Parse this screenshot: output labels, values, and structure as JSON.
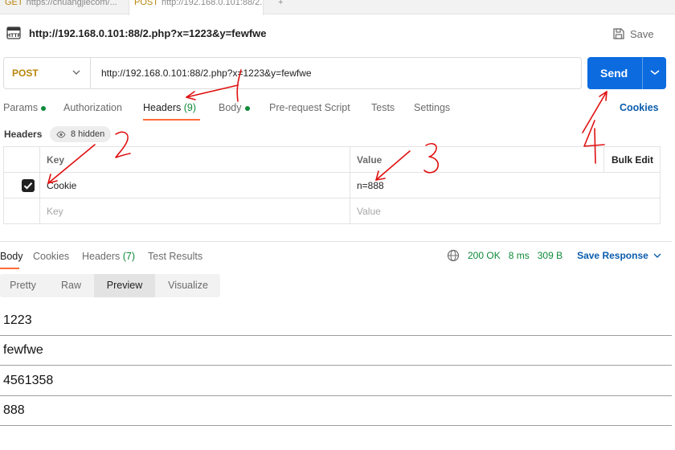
{
  "browser_tabs": [
    {
      "method": "GET",
      "label": "https://chuangjiecom/..."
    },
    {
      "method": "POST",
      "label": "http://192.168.0.101:88/2..."
    },
    {
      "label": "+"
    }
  ],
  "request": {
    "icon": "http-file-icon",
    "name": "http://192.168.0.101:88/2.php?x=1223&y=fewfwe",
    "save_label": "Save"
  },
  "url_bar": {
    "method": "POST",
    "url": "http://192.168.0.101:88/2.php?x=1223&y=fewfwe",
    "send_label": "Send"
  },
  "request_tabs": {
    "params": "Params",
    "authorization": "Authorization",
    "headers": "Headers",
    "headers_count": "(9)",
    "body": "Body",
    "pre_request": "Pre-request Script",
    "tests": "Tests",
    "settings": "Settings",
    "cookies": "Cookies"
  },
  "headers_section": {
    "label": "Headers",
    "hidden": "8 hidden",
    "columns": {
      "key": "Key",
      "value": "Value",
      "bulk_edit": "Bulk Edit"
    },
    "rows": [
      {
        "checked": true,
        "key": "Cookie",
        "value": "n=888"
      }
    ],
    "placeholder": {
      "key": "Key",
      "value": "Value"
    }
  },
  "response_tabs": {
    "body": "Body",
    "cookies": "Cookies",
    "headers": "Headers",
    "headers_count": "(7)",
    "test_results": "Test Results"
  },
  "response_status": {
    "status": "200 OK",
    "time": "8 ms",
    "size": "309 B",
    "save_response": "Save Response"
  },
  "view_modes": [
    "Pretty",
    "Raw",
    "Preview",
    "Visualize"
  ],
  "active_view": "Preview",
  "preview_output": [
    "1223",
    "fewfwe",
    "4561358",
    "888"
  ],
  "annotations": [
    "1",
    "2",
    "3",
    "4"
  ],
  "colors": {
    "accent": "#ff6c37",
    "send": "#0b6bdf",
    "method_post": "#b8860b",
    "status_ok": "#0f8a3a",
    "link": "#0b5cad",
    "annotation": "#e01010"
  }
}
